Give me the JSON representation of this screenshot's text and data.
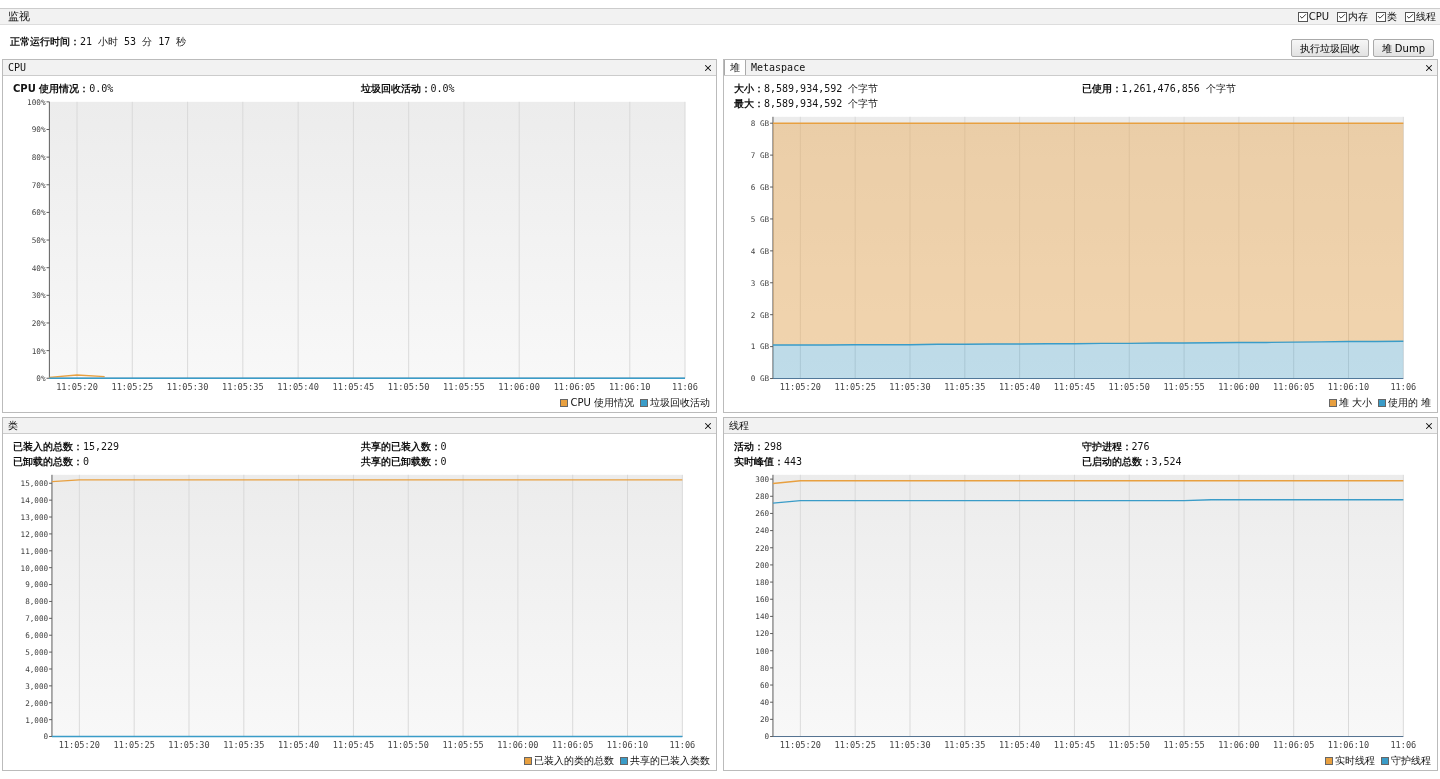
{
  "monitor_bar": {
    "title": "监视",
    "toggles": [
      {
        "label": "CPU",
        "checked": true
      },
      {
        "label": "内存",
        "checked": true
      },
      {
        "label": "类",
        "checked": true
      },
      {
        "label": "线程",
        "checked": true
      }
    ]
  },
  "uptime": {
    "label": "正常运行时间：",
    "value": "21 小时 53 分 17 秒"
  },
  "buttons": [
    "执行垃圾回收",
    "堆 Dump"
  ],
  "panels": [
    {
      "tabs": [
        {
          "label": "CPU",
          "selected": false
        }
      ],
      "stats": [
        {
          "label": "CPU 使用情况：",
          "value": "0.0%"
        },
        {
          "label": "垃圾回收活动：",
          "value": "0.0%"
        }
      ],
      "chart_data": {
        "type": "line",
        "grid": true,
        "categories": [
          null,
          "11:05:20",
          null,
          "11:05:25",
          null,
          "11:05:30",
          null,
          "11:05:35",
          null,
          "11:05:40",
          null,
          "11:05:45",
          null,
          "11:05:50",
          null,
          "11:05:55",
          null,
          "11:06:00",
          null,
          "11:06:05",
          null,
          "11:06:10",
          null,
          "11:06"
        ],
        "ylim": [
          0,
          100
        ],
        "yticks": [
          {
            "value": 0,
            "label": "0%"
          },
          {
            "value": 10,
            "label": "10%"
          },
          {
            "value": 20,
            "label": "20%"
          },
          {
            "value": 30,
            "label": "30%"
          },
          {
            "value": 40,
            "label": "40%"
          },
          {
            "value": 50,
            "label": "50%"
          },
          {
            "value": 60,
            "label": "60%"
          },
          {
            "value": 70,
            "label": "70%"
          },
          {
            "value": 80,
            "label": "80%"
          },
          {
            "value": 90,
            "label": "90%"
          },
          {
            "value": 100,
            "label": "100%"
          }
        ],
        "series": [
          {
            "name": "CPU 使用情况",
            "color": "#e8a040",
            "values": [
              0.3,
              1.2,
              0.6,
              null,
              null,
              null,
              null,
              null,
              null,
              null,
              null,
              null,
              null,
              null,
              null,
              null,
              null,
              null,
              null,
              null,
              null,
              null,
              null,
              null
            ]
          },
          {
            "name": "垃圾回收活动",
            "color": "#3a9cc8",
            "values": [
              0,
              0,
              0,
              0,
              0,
              0,
              0,
              0,
              0,
              0,
              0,
              0,
              0,
              0,
              0,
              0,
              0,
              0,
              0,
              0,
              0,
              0,
              0,
              0
            ]
          }
        ]
      }
    },
    {
      "tabs": [
        {
          "label": "堆",
          "selected": true
        },
        {
          "label": "Metaspace",
          "selected": false
        }
      ],
      "stats": [
        {
          "label": "大小：",
          "value": "8,589,934,592 个字节"
        },
        {
          "label": "已使用：",
          "value": "1,261,476,856 个字节"
        },
        {
          "label": "最大：",
          "value": "8,589,934,592 个字节"
        }
      ],
      "chart_data": {
        "type": "area",
        "grid": true,
        "categories": [
          null,
          "11:05:20",
          null,
          "11:05:25",
          null,
          "11:05:30",
          null,
          "11:05:35",
          null,
          "11:05:40",
          null,
          "11:05:45",
          null,
          "11:05:50",
          null,
          "11:05:55",
          null,
          "11:06:00",
          null,
          "11:06:05",
          null,
          "11:06:10",
          null,
          "11:06"
        ],
        "ylim": [
          0,
          8.2
        ],
        "yticks": [
          {
            "value": 0,
            "label": "0 GB"
          },
          {
            "value": 1,
            "label": "1 GB"
          },
          {
            "value": 2,
            "label": "2 GB"
          },
          {
            "value": 3,
            "label": "3 GB"
          },
          {
            "value": 4,
            "label": "4 GB"
          },
          {
            "value": 5,
            "label": "5 GB"
          },
          {
            "value": 6,
            "label": "6 GB"
          },
          {
            "value": 7,
            "label": "7 GB"
          },
          {
            "value": 8,
            "label": "8 GB"
          }
        ],
        "series": [
          {
            "name": "堆 大小",
            "color": "#e8a040",
            "values": [
              8,
              8,
              8,
              8,
              8,
              8,
              8,
              8,
              8,
              8,
              8,
              8,
              8,
              8,
              8,
              8,
              8,
              8,
              8,
              8,
              8,
              8,
              8,
              8
            ]
          },
          {
            "name": "使用的 堆",
            "color": "#3a9cc8",
            "values": [
              1.05,
              1.05,
              1.05,
              1.06,
              1.06,
              1.06,
              1.07,
              1.07,
              1.08,
              1.08,
              1.09,
              1.09,
              1.1,
              1.1,
              1.11,
              1.11,
              1.12,
              1.13,
              1.13,
              1.14,
              1.15,
              1.16,
              1.16,
              1.17
            ]
          }
        ]
      }
    },
    {
      "tabs": [
        {
          "label": "类",
          "selected": false
        }
      ],
      "stats": [
        {
          "label": "已装入的总数：",
          "value": "15,229"
        },
        {
          "label": "共享的已装入数：",
          "value": "0"
        },
        {
          "label": "已卸载的总数：",
          "value": "0"
        },
        {
          "label": "共享的已卸载数：",
          "value": "0"
        }
      ],
      "chart_data": {
        "type": "line",
        "categories": [
          null,
          "11:05:20",
          null,
          "11:05:25",
          null,
          "11:05:30",
          null,
          "11:05:35",
          null,
          "11:05:40",
          null,
          "11:05:45",
          null,
          "11:05:50",
          null,
          "11:05:55",
          null,
          "11:06:00",
          null,
          "11:06:05",
          null,
          "11:06:10",
          null,
          "11:06"
        ],
        "ylim": [
          0,
          15500
        ],
        "grid": true,
        "yticks": [
          {
            "value": 0,
            "label": "0"
          },
          {
            "value": 1000,
            "label": "1,000"
          },
          {
            "value": 2000,
            "label": "2,000"
          },
          {
            "value": 3000,
            "label": "3,000"
          },
          {
            "value": 4000,
            "label": "4,000"
          },
          {
            "value": 5000,
            "label": "5,000"
          },
          {
            "value": 6000,
            "label": "6,000"
          },
          {
            "value": 7000,
            "label": "7,000"
          },
          {
            "value": 8000,
            "label": "8,000"
          },
          {
            "value": 9000,
            "label": "9,000"
          },
          {
            "value": 10000,
            "label": "10,000"
          },
          {
            "value": 11000,
            "label": "11,000"
          },
          {
            "value": 12000,
            "label": "12,000"
          },
          {
            "value": 13000,
            "label": "13,000"
          },
          {
            "value": 14000,
            "label": "14,000"
          },
          {
            "value": 15000,
            "label": "15,000"
          }
        ],
        "series": [
          {
            "name": "已装入的类的总数",
            "color": "#e8a040",
            "values": [
              15100,
              15200,
              15200,
              15200,
              15200,
              15200,
              15200,
              15200,
              15200,
              15200,
              15200,
              15200,
              15200,
              15200,
              15200,
              15200,
              15200,
              15200,
              15200,
              15200,
              15200,
              15200,
              15200,
              15200
            ]
          },
          {
            "name": "共享的已装入类数",
            "color": "#3a9cc8",
            "values": [
              0,
              0,
              0,
              0,
              0,
              0,
              0,
              0,
              0,
              0,
              0,
              0,
              0,
              0,
              0,
              0,
              0,
              0,
              0,
              0,
              0,
              0,
              0,
              0
            ]
          }
        ]
      }
    },
    {
      "tabs": [
        {
          "label": "线程",
          "selected": false
        }
      ],
      "stats": [
        {
          "label": "活动：",
          "value": "298"
        },
        {
          "label": "守护进程：",
          "value": "276"
        },
        {
          "label": "实时峰值：",
          "value": "443"
        },
        {
          "label": "已启动的总数：",
          "value": "3,524"
        }
      ],
      "chart_data": {
        "type": "line",
        "categories": [
          null,
          "11:05:20",
          null,
          "11:05:25",
          null,
          "11:05:30",
          null,
          "11:05:35",
          null,
          "11:05:40",
          null,
          "11:05:45",
          null,
          "11:05:50",
          null,
          "11:05:55",
          null,
          "11:06:00",
          null,
          "11:06:05",
          null,
          "11:06:10",
          null,
          "11:06"
        ],
        "ylim": [
          0,
          305
        ],
        "grid": true,
        "yticks": [
          {
            "value": 0,
            "label": "0"
          },
          {
            "value": 20,
            "label": "20"
          },
          {
            "value": 40,
            "label": "40"
          },
          {
            "value": 60,
            "label": "60"
          },
          {
            "value": 80,
            "label": "80"
          },
          {
            "value": 100,
            "label": "100"
          },
          {
            "value": 120,
            "label": "120"
          },
          {
            "value": 140,
            "label": "140"
          },
          {
            "value": 160,
            "label": "160"
          },
          {
            "value": 180,
            "label": "180"
          },
          {
            "value": 200,
            "label": "200"
          },
          {
            "value": 220,
            "label": "220"
          },
          {
            "value": 240,
            "label": "240"
          },
          {
            "value": 260,
            "label": "260"
          },
          {
            "value": 280,
            "label": "280"
          },
          {
            "value": 300,
            "label": "300"
          }
        ],
        "series": [
          {
            "name": "实时线程",
            "color": "#e8a040",
            "values": [
              295,
              298,
              298,
              298,
              298,
              298,
              298,
              298,
              298,
              298,
              298,
              298,
              298,
              298,
              298,
              298,
              298,
              298,
              298,
              298,
              298,
              298,
              298,
              298
            ]
          },
          {
            "name": "守护线程",
            "color": "#3a9cc8",
            "values": [
              272,
              275,
              275,
              275,
              275,
              275,
              275,
              275,
              275,
              275,
              275,
              275,
              275,
              275,
              275,
              275,
              276,
              276,
              276,
              276,
              276,
              276,
              276,
              276
            ]
          }
        ]
      }
    }
  ]
}
